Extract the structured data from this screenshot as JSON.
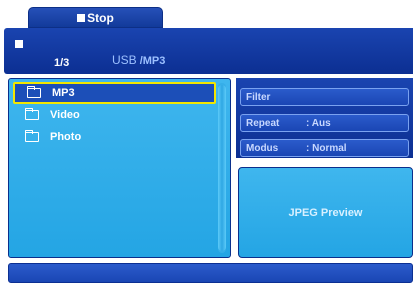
{
  "toolbar": {
    "stop_label": "Stop",
    "stop_icon": "stop-square"
  },
  "header": {
    "page_count": "1/3",
    "source": "USB",
    "path": "/MP3",
    "play_icon": "square"
  },
  "file_list": {
    "items": [
      {
        "label": "MP3",
        "icon": "folder",
        "selected": true
      },
      {
        "label": "Video",
        "icon": "folder",
        "selected": false
      },
      {
        "label": "Photo",
        "icon": "folder",
        "selected": false
      }
    ]
  },
  "options": {
    "filter": {
      "label": "Filter"
    },
    "repeat": {
      "label": "Repeat",
      "value": ": Aus"
    },
    "modus": {
      "label": "Modus",
      "value": ": Normal"
    }
  },
  "preview": {
    "label": "JPEG Preview"
  },
  "colors": {
    "accent": "#1a44b0",
    "panel": "#3fb6ee",
    "highlight": "#f2e600"
  }
}
